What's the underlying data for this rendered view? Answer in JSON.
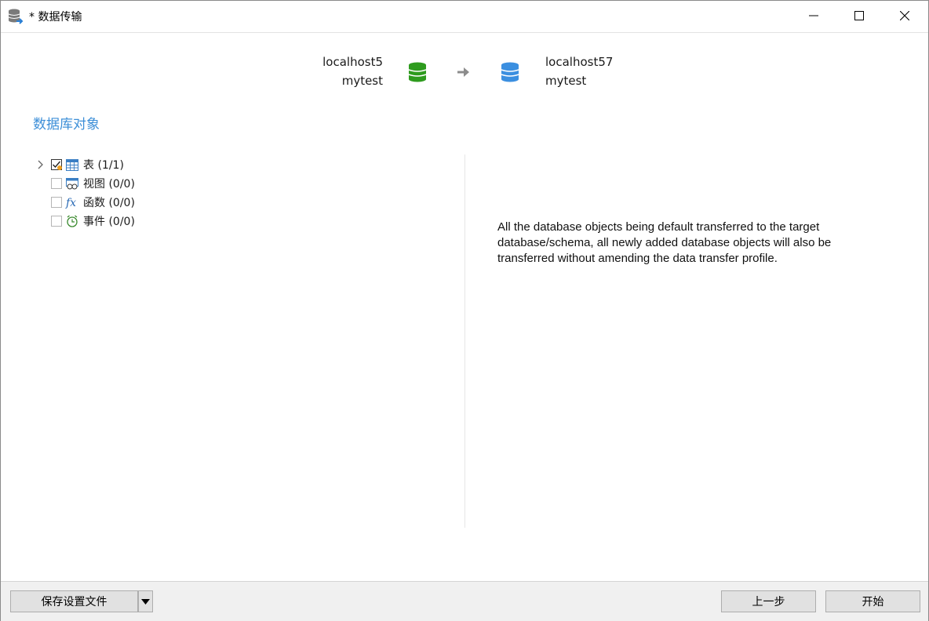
{
  "window": {
    "title": "* 数据传输"
  },
  "connection": {
    "source": {
      "host": "localhost5",
      "database": "mytest",
      "icon": "database-green-icon",
      "color": "#2e9b1e"
    },
    "target": {
      "host": "localhost57",
      "database": "mytest",
      "icon": "database-blue-icon",
      "color": "#3b8fe0"
    }
  },
  "section": {
    "title": "数据库对象"
  },
  "tree": [
    {
      "label": "表  (1/1)",
      "checked": true,
      "icon": "table-icon",
      "expandable": true
    },
    {
      "label": "视图  (0/0)",
      "checked": false,
      "icon": "view-icon",
      "expandable": false
    },
    {
      "label": "函数  (0/0)",
      "checked": false,
      "icon": "function-icon",
      "expandable": false
    },
    {
      "label": "事件  (0/0)",
      "checked": false,
      "icon": "event-icon",
      "expandable": false
    }
  ],
  "description": "All the database objects being default transferred to the target database/schema, all newly added database objects will also be transferred without amending the data transfer profile.",
  "footer": {
    "save_label": "保存设置文件",
    "prev_label": "上一步",
    "start_label": "开始"
  },
  "colors": {
    "accent": "#3d8fd8"
  }
}
